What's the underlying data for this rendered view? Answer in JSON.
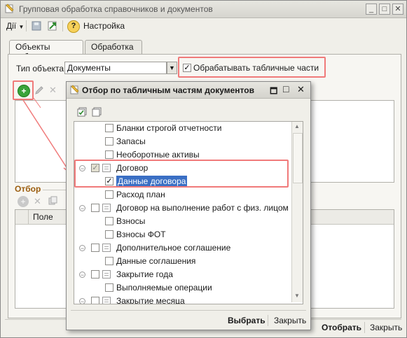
{
  "window": {
    "title": "Групповая обработка справочников и документов",
    "controls": {
      "minimize": "_",
      "maximize": "□",
      "close": "✕"
    }
  },
  "toolbar": {
    "actions_label": "Дії",
    "settings_label": "Настройка",
    "help_icon_glyph": "?"
  },
  "tabs": [
    {
      "label": "Объекты отбора",
      "active": true
    },
    {
      "label": "Обработка",
      "active": false
    }
  ],
  "object_type": {
    "label": "Тип объекта:",
    "value": "Документы",
    "dropdown_glyph": "▼"
  },
  "process_tabular": {
    "checked": true,
    "label": "Обрабатывать табличные части"
  },
  "filter_section": {
    "label": "Отбор",
    "column_field": "Поле"
  },
  "footer": {
    "select_label": "Отобрать",
    "close_label": "Закрыть"
  },
  "dialog": {
    "title": "Отбор по табличным частям документов",
    "select_button": "Выбрать",
    "close_button": "Закрыть",
    "controls": {
      "maximize": "□",
      "close": "✕"
    },
    "tree": [
      {
        "label": "Бланки строгой отчетности",
        "level": 1,
        "checked": false
      },
      {
        "label": "Запасы",
        "level": 1,
        "checked": false
      },
      {
        "label": "Необоротные активы",
        "level": 1,
        "checked": false
      },
      {
        "label": "Договор",
        "level": 0,
        "checked": "partial",
        "expanded": true
      },
      {
        "label": "Данные договора",
        "level": 1,
        "checked": true,
        "selected": true
      },
      {
        "label": "Расход план",
        "level": 1,
        "checked": false
      },
      {
        "label": "Договор на выполнение работ с физ. лицом",
        "level": 0,
        "checked": false,
        "expanded": true
      },
      {
        "label": "Взносы",
        "level": 1,
        "checked": false
      },
      {
        "label": "Взносы ФОТ",
        "level": 1,
        "checked": false
      },
      {
        "label": "Дополнительное соглашение",
        "level": 0,
        "checked": false,
        "expanded": true
      },
      {
        "label": "Данные соглашения",
        "level": 1,
        "checked": false
      },
      {
        "label": "Закрытие года",
        "level": 0,
        "checked": false,
        "expanded": true
      },
      {
        "label": "Выполняемые операции",
        "level": 1,
        "checked": false
      },
      {
        "label": "Закрытие месяца",
        "level": 0,
        "checked": false,
        "expanded": true
      }
    ]
  },
  "colors": {
    "highlight_frame": "#f07a7a",
    "selection": "#3a6fc4",
    "group_label": "#9b5d0e",
    "add_button": "#3aa33a"
  }
}
